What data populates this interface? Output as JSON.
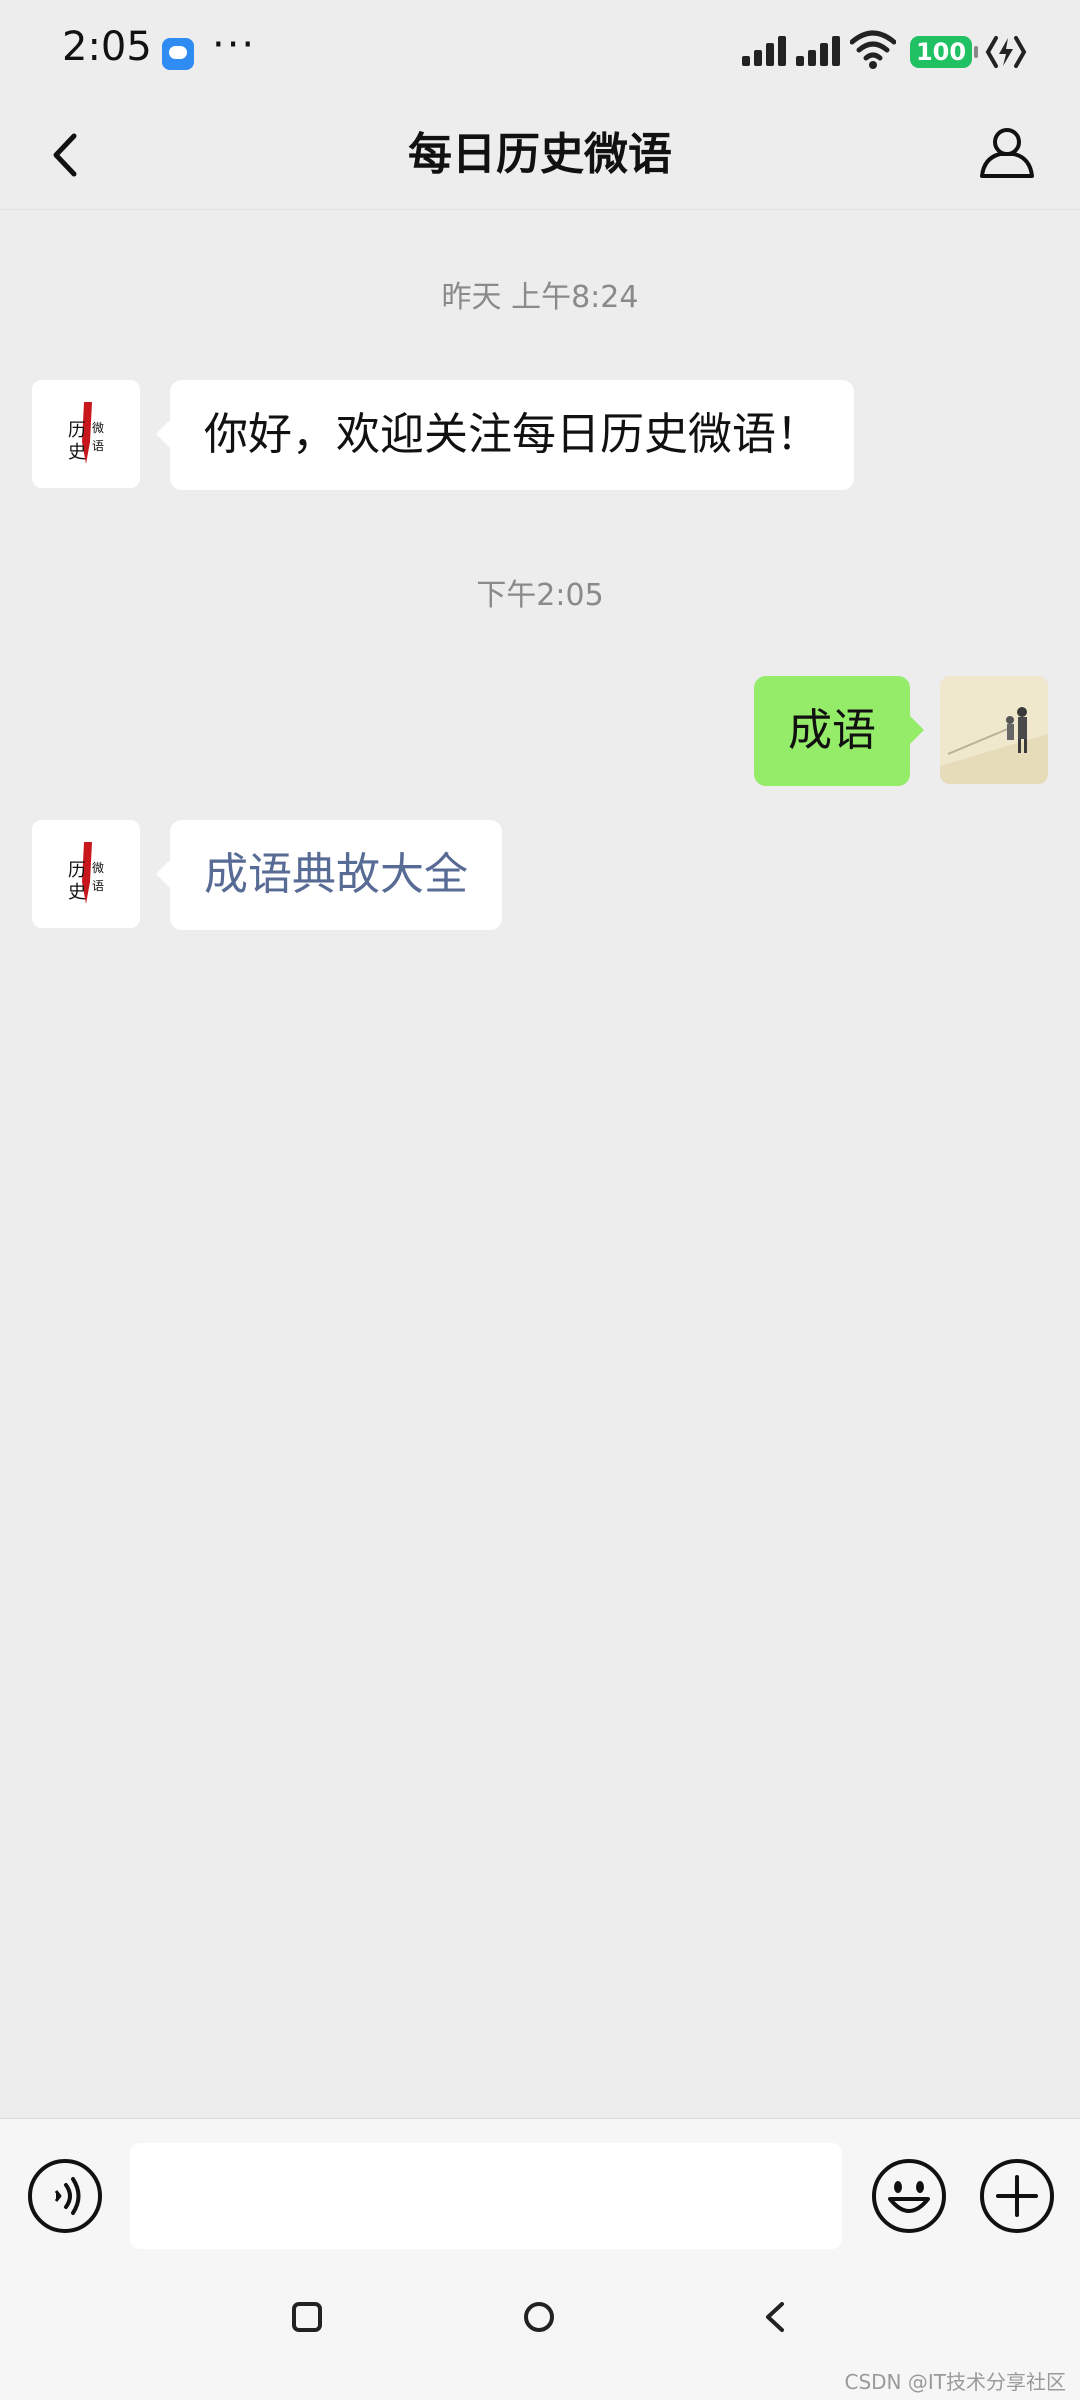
{
  "status_bar": {
    "time": "2:05",
    "dots": "···",
    "battery": "100"
  },
  "header": {
    "title": "每日历史微语"
  },
  "chat": {
    "timestamps": [
      "昨天 上午8:24",
      "下午2:05"
    ],
    "messages": [
      {
        "from": "official-account",
        "text": "你好，欢迎关注每日历史微语！"
      },
      {
        "from": "me",
        "text": "成语"
      },
      {
        "from": "official-account",
        "text": "成语典故大全"
      }
    ],
    "avatar_text": "历史微语"
  },
  "input_bar": {
    "value": ""
  },
  "watermark": "CSDN @IT技术分享社区",
  "colors": {
    "background": "#ededed",
    "outgoing_bubble": "#95ec69",
    "incoming_bubble": "#ffffff",
    "link": "#576b95",
    "battery": "#1fc162",
    "app_icon": "#2f8cf3"
  },
  "icons": {
    "back": "chevron-left-icon",
    "profile": "person-icon",
    "voice": "voice-icon",
    "emoji": "smiley-icon",
    "plus": "plus-circle-icon",
    "wifi": "wifi-icon",
    "signal": "signal-icon",
    "charging": "lightning-icon"
  }
}
